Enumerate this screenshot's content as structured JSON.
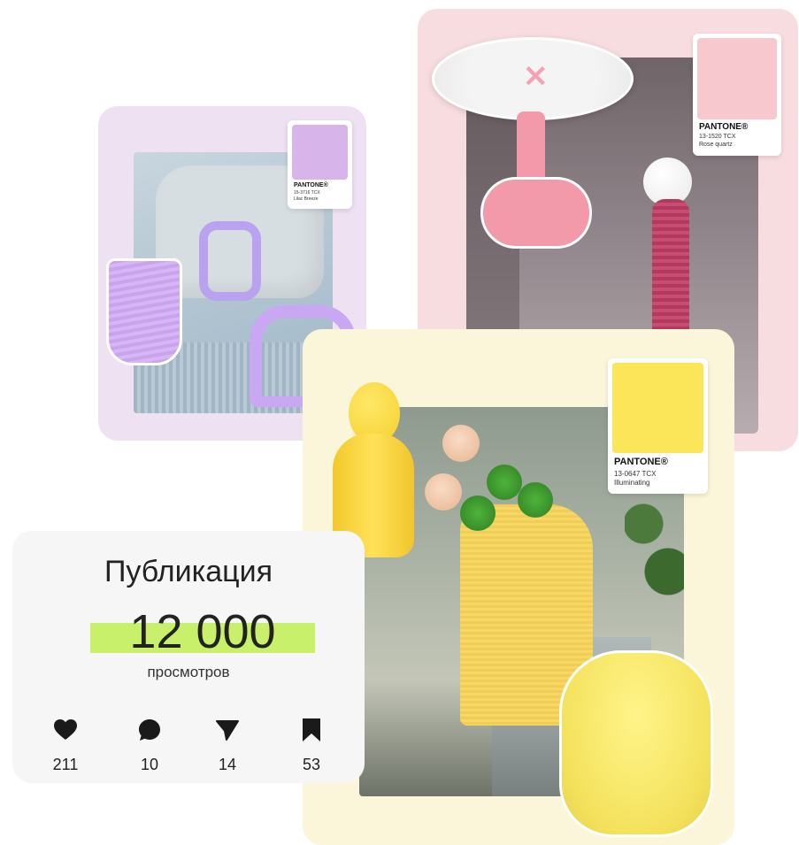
{
  "pantone_cards": {
    "rose": {
      "brand": "PANTONE®",
      "code": "13-1520 TCX",
      "name": "Rose quartz"
    },
    "lilac": {
      "brand": "PANTONE®",
      "code": "15-3716 TCX",
      "name": "Lilac Breeze"
    },
    "illuminating": {
      "brand": "PANTONE®",
      "code": "13-0647 TCX",
      "name": "Illuminating"
    }
  },
  "stats": {
    "title": "Публикация",
    "views_count": "12 000",
    "views_label": "просмотров",
    "metrics": [
      {
        "icon": "heart-icon",
        "value": "211"
      },
      {
        "icon": "comment-icon",
        "value": "10"
      },
      {
        "icon": "send-icon",
        "value": "14"
      },
      {
        "icon": "bookmark-icon",
        "value": "53"
      }
    ]
  },
  "colors": {
    "rose_quartz": "#f7c9ce",
    "lilac_breeze": "#d7b4ea",
    "illuminating": "#fbe559",
    "highlight": "#c9f06a"
  }
}
